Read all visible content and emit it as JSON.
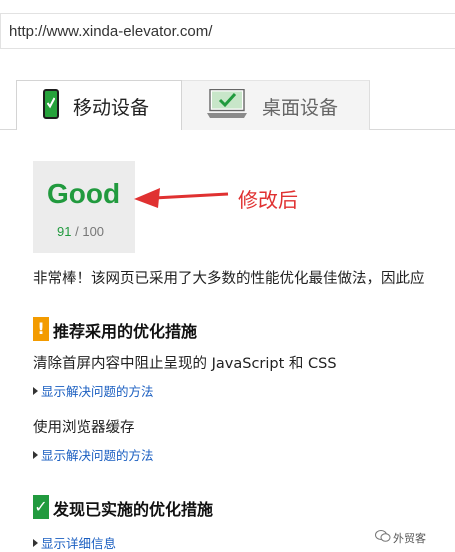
{
  "browser": {
    "url": "http://www.xinda-elevator.com/"
  },
  "tabs": [
    {
      "label": "移动设备",
      "icon": "phone-check-icon",
      "active": true
    },
    {
      "label": "桌面设备",
      "icon": "monitor-check-icon",
      "active": false
    }
  ],
  "score": {
    "rating": "Good",
    "value": "91",
    "separator": "/",
    "max": "100",
    "color": "#219a3e"
  },
  "annotation": {
    "text": "修改后",
    "color": "#e03131"
  },
  "summary": "非常棒！该网页已采用了大多数的性能优化最佳做法，因此应",
  "sections": {
    "recommended": {
      "title": "推荐采用的优化措施",
      "badge": "!",
      "badge_color": "#f39b00",
      "rules": [
        {
          "title": "清除首屏内容中阻止呈现的 JavaScript 和 CSS",
          "link": "显示解决问题的方法"
        },
        {
          "title": "使用浏览器缓存",
          "link": "显示解决问题的方法"
        }
      ]
    },
    "passed": {
      "title": "发现已实施的优化措施",
      "badge": "✓",
      "badge_color": "#219a3e",
      "link": "显示详细信息"
    }
  },
  "watermark": "外贸客"
}
